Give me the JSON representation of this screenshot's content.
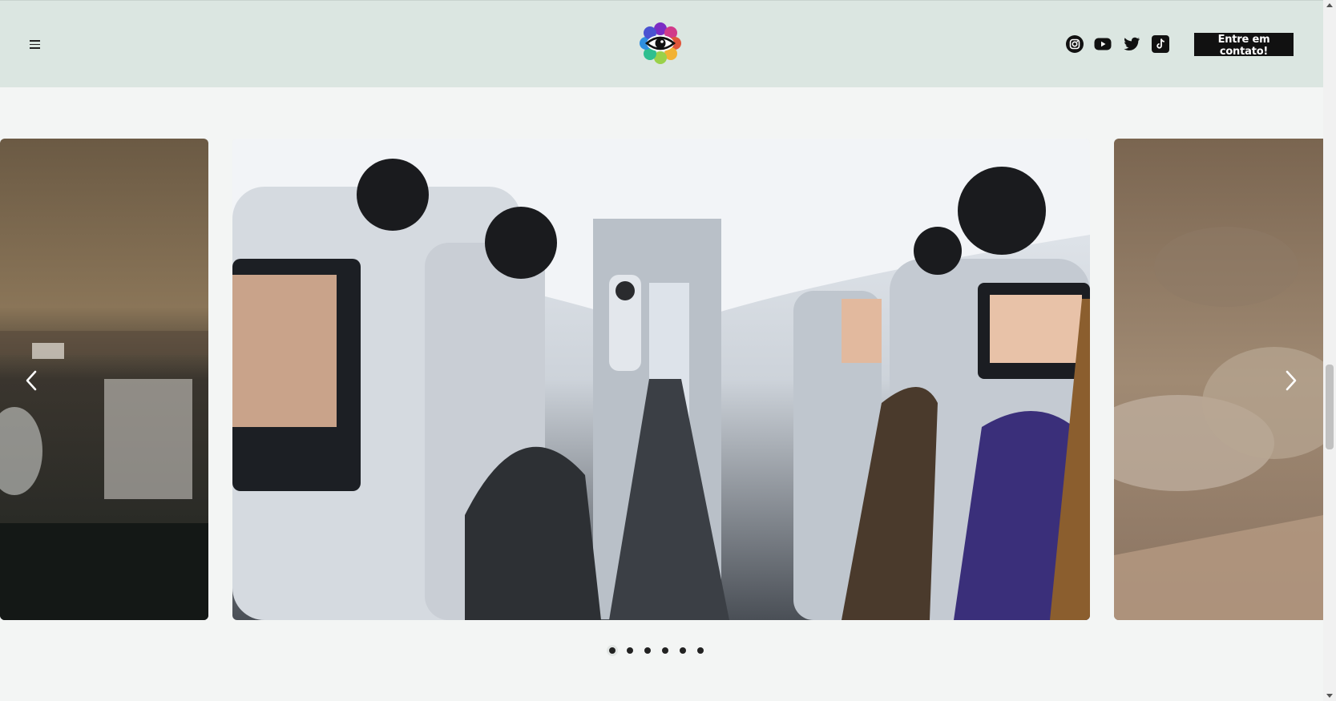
{
  "header": {
    "menu_icon": "hamburger-menu-icon",
    "logo_icon": "eye-flower-logo-icon",
    "social_icons": [
      "instagram-icon",
      "youtube-icon",
      "twitter-icon",
      "tiktok-icon"
    ],
    "cta_label": "Entre em contato!"
  },
  "carousel": {
    "slides": [
      {
        "subject": "airport-terminal-photo"
      },
      {
        "subject": "airplane-cabin-photo"
      },
      {
        "subject": "clouds-from-window-photo"
      }
    ],
    "prev_icon": "chevron-left-icon",
    "next_icon": "chevron-right-icon",
    "dot_count": 6,
    "active_dot": 1
  },
  "colors": {
    "header_bg": "#dbe6e1",
    "page_bg": "#f3f5f4",
    "cta_bg": "#111111"
  }
}
